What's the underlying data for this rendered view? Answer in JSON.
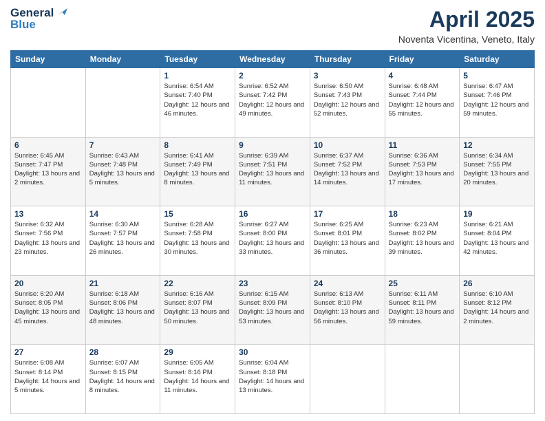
{
  "header": {
    "logo_line1": "General",
    "logo_line2": "Blue",
    "month": "April 2025",
    "location": "Noventa Vicentina, Veneto, Italy"
  },
  "weekdays": [
    "Sunday",
    "Monday",
    "Tuesday",
    "Wednesday",
    "Thursday",
    "Friday",
    "Saturday"
  ],
  "weeks": [
    [
      {
        "day": "",
        "info": ""
      },
      {
        "day": "",
        "info": ""
      },
      {
        "day": "1",
        "info": "Sunrise: 6:54 AM\nSunset: 7:40 PM\nDaylight: 12 hours and 46 minutes."
      },
      {
        "day": "2",
        "info": "Sunrise: 6:52 AM\nSunset: 7:42 PM\nDaylight: 12 hours and 49 minutes."
      },
      {
        "day": "3",
        "info": "Sunrise: 6:50 AM\nSunset: 7:43 PM\nDaylight: 12 hours and 52 minutes."
      },
      {
        "day": "4",
        "info": "Sunrise: 6:48 AM\nSunset: 7:44 PM\nDaylight: 12 hours and 55 minutes."
      },
      {
        "day": "5",
        "info": "Sunrise: 6:47 AM\nSunset: 7:46 PM\nDaylight: 12 hours and 59 minutes."
      }
    ],
    [
      {
        "day": "6",
        "info": "Sunrise: 6:45 AM\nSunset: 7:47 PM\nDaylight: 13 hours and 2 minutes."
      },
      {
        "day": "7",
        "info": "Sunrise: 6:43 AM\nSunset: 7:48 PM\nDaylight: 13 hours and 5 minutes."
      },
      {
        "day": "8",
        "info": "Sunrise: 6:41 AM\nSunset: 7:49 PM\nDaylight: 13 hours and 8 minutes."
      },
      {
        "day": "9",
        "info": "Sunrise: 6:39 AM\nSunset: 7:51 PM\nDaylight: 13 hours and 11 minutes."
      },
      {
        "day": "10",
        "info": "Sunrise: 6:37 AM\nSunset: 7:52 PM\nDaylight: 13 hours and 14 minutes."
      },
      {
        "day": "11",
        "info": "Sunrise: 6:36 AM\nSunset: 7:53 PM\nDaylight: 13 hours and 17 minutes."
      },
      {
        "day": "12",
        "info": "Sunrise: 6:34 AM\nSunset: 7:55 PM\nDaylight: 13 hours and 20 minutes."
      }
    ],
    [
      {
        "day": "13",
        "info": "Sunrise: 6:32 AM\nSunset: 7:56 PM\nDaylight: 13 hours and 23 minutes."
      },
      {
        "day": "14",
        "info": "Sunrise: 6:30 AM\nSunset: 7:57 PM\nDaylight: 13 hours and 26 minutes."
      },
      {
        "day": "15",
        "info": "Sunrise: 6:28 AM\nSunset: 7:58 PM\nDaylight: 13 hours and 30 minutes."
      },
      {
        "day": "16",
        "info": "Sunrise: 6:27 AM\nSunset: 8:00 PM\nDaylight: 13 hours and 33 minutes."
      },
      {
        "day": "17",
        "info": "Sunrise: 6:25 AM\nSunset: 8:01 PM\nDaylight: 13 hours and 36 minutes."
      },
      {
        "day": "18",
        "info": "Sunrise: 6:23 AM\nSunset: 8:02 PM\nDaylight: 13 hours and 39 minutes."
      },
      {
        "day": "19",
        "info": "Sunrise: 6:21 AM\nSunset: 8:04 PM\nDaylight: 13 hours and 42 minutes."
      }
    ],
    [
      {
        "day": "20",
        "info": "Sunrise: 6:20 AM\nSunset: 8:05 PM\nDaylight: 13 hours and 45 minutes."
      },
      {
        "day": "21",
        "info": "Sunrise: 6:18 AM\nSunset: 8:06 PM\nDaylight: 13 hours and 48 minutes."
      },
      {
        "day": "22",
        "info": "Sunrise: 6:16 AM\nSunset: 8:07 PM\nDaylight: 13 hours and 50 minutes."
      },
      {
        "day": "23",
        "info": "Sunrise: 6:15 AM\nSunset: 8:09 PM\nDaylight: 13 hours and 53 minutes."
      },
      {
        "day": "24",
        "info": "Sunrise: 6:13 AM\nSunset: 8:10 PM\nDaylight: 13 hours and 56 minutes."
      },
      {
        "day": "25",
        "info": "Sunrise: 6:11 AM\nSunset: 8:11 PM\nDaylight: 13 hours and 59 minutes."
      },
      {
        "day": "26",
        "info": "Sunrise: 6:10 AM\nSunset: 8:12 PM\nDaylight: 14 hours and 2 minutes."
      }
    ],
    [
      {
        "day": "27",
        "info": "Sunrise: 6:08 AM\nSunset: 8:14 PM\nDaylight: 14 hours and 5 minutes."
      },
      {
        "day": "28",
        "info": "Sunrise: 6:07 AM\nSunset: 8:15 PM\nDaylight: 14 hours and 8 minutes."
      },
      {
        "day": "29",
        "info": "Sunrise: 6:05 AM\nSunset: 8:16 PM\nDaylight: 14 hours and 11 minutes."
      },
      {
        "day": "30",
        "info": "Sunrise: 6:04 AM\nSunset: 8:18 PM\nDaylight: 14 hours and 13 minutes."
      },
      {
        "day": "",
        "info": ""
      },
      {
        "day": "",
        "info": ""
      },
      {
        "day": "",
        "info": ""
      }
    ]
  ]
}
